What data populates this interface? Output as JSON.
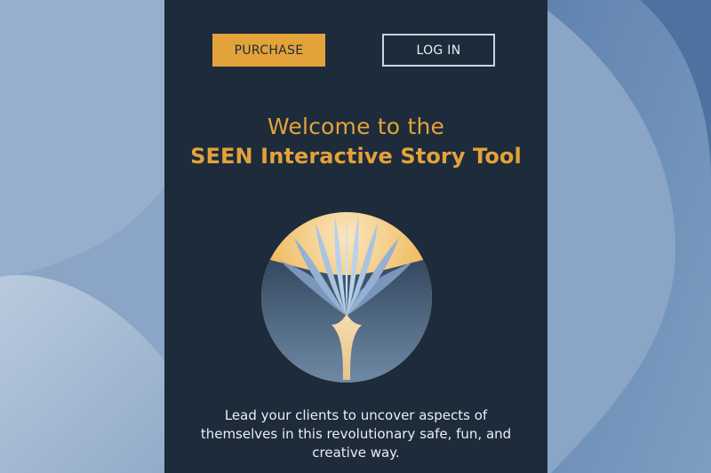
{
  "buttons": {
    "purchase_label": "PURCHASE",
    "login_label": "LOG IN"
  },
  "hero": {
    "title_line1": "Welcome to the",
    "title_line2": "SEEN Interactive Story Tool",
    "tagline": "Lead your clients to uncover aspects of themselves in this revolutionary safe, fun, and creative way."
  },
  "logo": {
    "icon": "fan-tree-icon"
  },
  "colors": {
    "accent": "#e3a23a",
    "panel_bg": "#1d2b3a",
    "background": "#86a1c2",
    "text_light": "#e9eef4"
  }
}
